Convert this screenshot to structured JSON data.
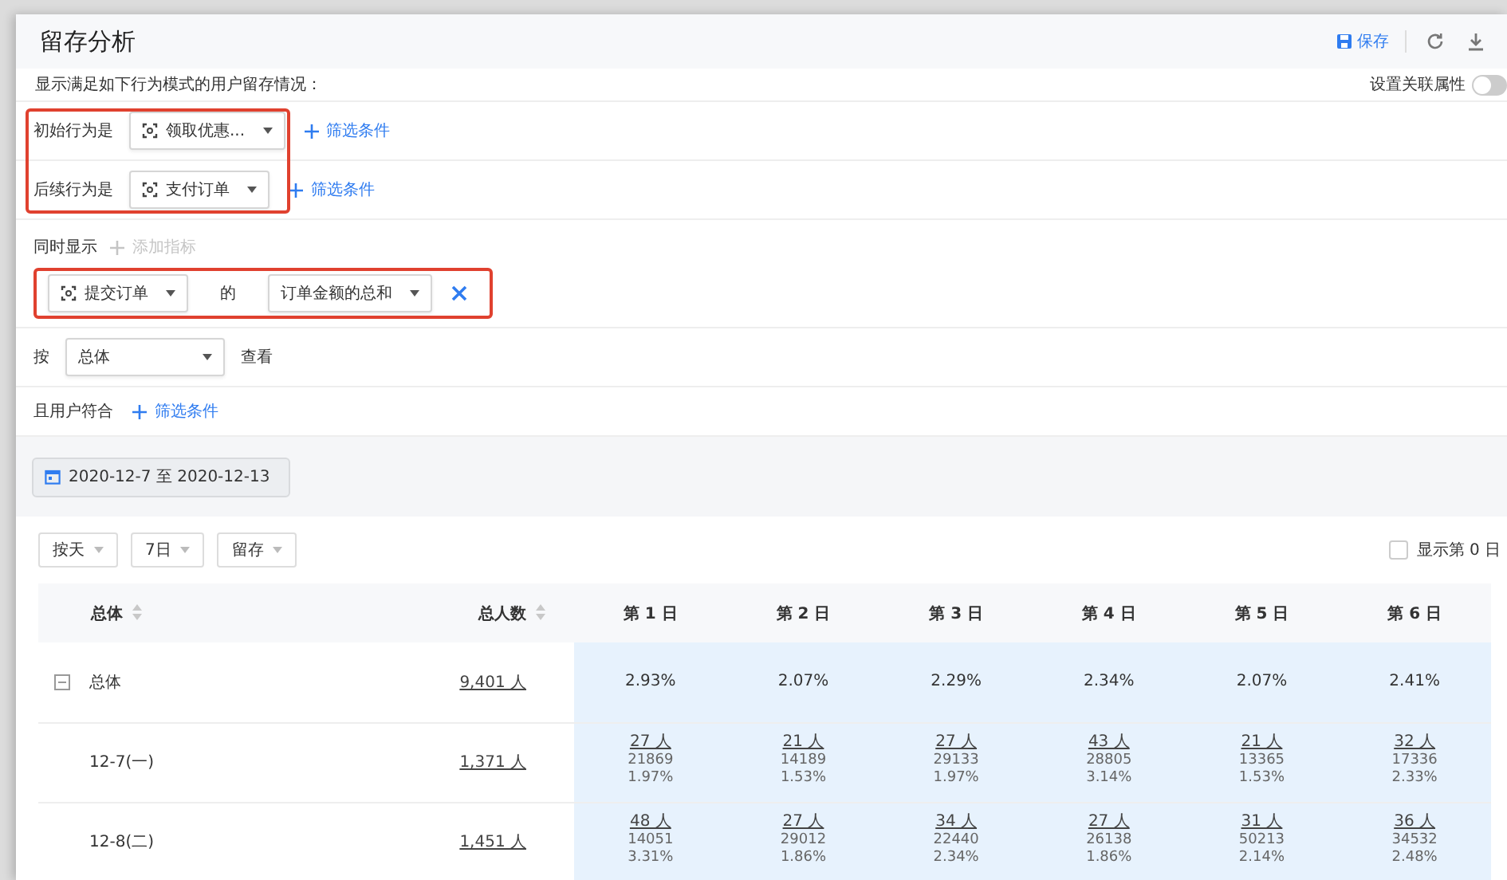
{
  "page": {
    "title": "留存分析",
    "actions": [
      {
        "kind": "save",
        "label": "保存"
      },
      {
        "kind": "refresh"
      },
      {
        "kind": "download"
      }
    ]
  },
  "description": "显示满足如下行为模式的用户留存情况：",
  "link_toggle": {
    "label": "设置关联属性",
    "on": false
  },
  "behaviors": [
    {
      "label": "初始行为是",
      "event": "领取优惠...",
      "filter": "筛选条件"
    },
    {
      "label": "后续行为是",
      "event": "支付订单",
      "filter": "筛选条件"
    }
  ],
  "also_show": {
    "label": "同时显示",
    "add": "添加指标",
    "event": "提交订单",
    "joiner": "的",
    "measure": "订单金额的总和"
  },
  "group_by": {
    "label": "按",
    "value": "总体",
    "suffix": "查看"
  },
  "user_filter": {
    "label": "且用户符合",
    "filter": "筛选条件"
  },
  "date_range": "2020-12-7 至 2020-12-13",
  "options": [
    "按天",
    "7日",
    "留存"
  ],
  "show_day0": {
    "label": "显示第 0 日",
    "checked": false
  },
  "table": {
    "columns": [
      {
        "label": "总体",
        "sortable": true
      },
      {
        "label": "总人数",
        "sortable": true
      },
      {
        "label": "第 1 日",
        "sortable": false
      },
      {
        "label": "第 2 日",
        "sortable": false
      },
      {
        "label": "第 3 日",
        "sortable": false
      },
      {
        "label": "第 4 日",
        "sortable": false
      },
      {
        "label": "第 5 日",
        "sortable": false
      },
      {
        "label": "第 6 日",
        "sortable": false
      }
    ],
    "rows": [
      {
        "kind": "total",
        "label": "总体",
        "expanded": true,
        "users": "9,401 人",
        "days": [
          {
            "rate": "2.93%"
          },
          {
            "rate": "2.07%"
          },
          {
            "rate": "2.29%"
          },
          {
            "rate": "2.34%"
          },
          {
            "rate": "2.07%"
          },
          {
            "rate": "2.41%"
          }
        ]
      },
      {
        "kind": "day",
        "label": "12-7(一)",
        "users": "1,371 人",
        "days": [
          {
            "users": "27 人",
            "amount": "21869",
            "rate": "1.97%"
          },
          {
            "users": "21 人",
            "amount": "14189",
            "rate": "1.53%"
          },
          {
            "users": "27 人",
            "amount": "29133",
            "rate": "1.97%"
          },
          {
            "users": "43 人",
            "amount": "28805",
            "rate": "3.14%"
          },
          {
            "users": "21 人",
            "amount": "13365",
            "rate": "1.53%"
          },
          {
            "users": "32 人",
            "amount": "17336",
            "rate": "2.33%"
          }
        ]
      },
      {
        "kind": "day",
        "label": "12-8(二)",
        "users": "1,451 人",
        "days": [
          {
            "users": "48 人",
            "amount": "14051",
            "rate": "3.31%"
          },
          {
            "users": "27 人",
            "amount": "29012",
            "rate": "1.86%"
          },
          {
            "users": "34 人",
            "amount": "22440",
            "rate": "2.34%"
          },
          {
            "users": "27 人",
            "amount": "26138",
            "rate": "1.86%"
          },
          {
            "users": "31 人",
            "amount": "50213",
            "rate": "2.14%"
          },
          {
            "users": "36 人",
            "amount": "34532",
            "rate": "2.48%"
          }
        ]
      }
    ]
  }
}
